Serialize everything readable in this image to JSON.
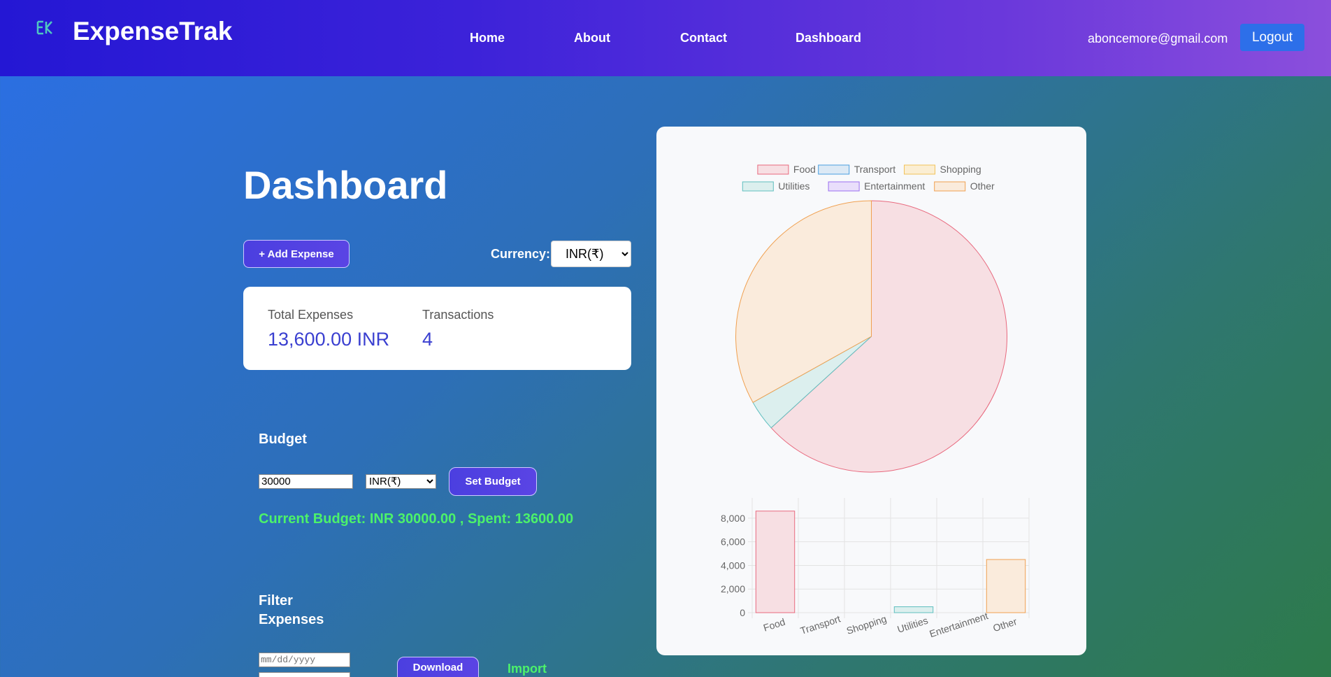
{
  "header": {
    "brand": "ExpenseTrak",
    "nav": [
      {
        "label": "Home"
      },
      {
        "label": "About"
      },
      {
        "label": "Contact"
      },
      {
        "label": "Dashboard"
      }
    ],
    "user_email": "aboncemore@gmail.com",
    "logout_label": "Logout",
    "colors": {
      "accent": "#2d6fe9",
      "nav_start": "#2417d4",
      "nav_end": "#8b4fdc"
    }
  },
  "dashboard": {
    "title": "Dashboard",
    "add_expense_label": "+ Add Expense",
    "currency_label": "Currency:",
    "currency_value": "INR(₹)"
  },
  "summary": {
    "total_label": "Total Expenses",
    "total_value": "13,600.00 INR",
    "transactions_label": "Transactions",
    "transactions_value": "4"
  },
  "budget": {
    "title": "Budget",
    "input_value": "30000",
    "currency_value": "INR(₹)",
    "set_label": "Set Budget",
    "status": "Current Budget: INR 30000.00 , Spent: 13600.00"
  },
  "filter": {
    "title_line1": "Filter",
    "title_line2": "Expenses",
    "date_placeholder": "mm/dd/yyyy",
    "download_label": "Download",
    "import_label": "Import"
  },
  "chart_data": [
    {
      "type": "pie",
      "legend": [
        "Food",
        "Transport",
        "Shopping",
        "Utilities",
        "Entertainment",
        "Other"
      ],
      "legend_placement": "top",
      "categories": [
        "Food",
        "Transport",
        "Shopping",
        "Utilities",
        "Entertainment",
        "Other"
      ],
      "values": [
        8600,
        0,
        0,
        500,
        0,
        4500
      ],
      "colors": [
        "#e8697e",
        "#4a9fe0",
        "#f2c25a",
        "#5fbfbf",
        "#9b6ff0",
        "#f0a050"
      ],
      "fills": [
        "#f7dfe3",
        "#dce9f5",
        "#fbeed3",
        "#dcefee",
        "#e9defb",
        "#faebdc"
      ]
    },
    {
      "type": "bar",
      "categories": [
        "Food",
        "Transport",
        "Shopping",
        "Utilities",
        "Entertainment",
        "Other"
      ],
      "values": [
        8600,
        0,
        0,
        500,
        0,
        4500
      ],
      "ylim": [
        0,
        9000
      ],
      "yticks": [
        "8,000",
        "6,000",
        "4,000",
        "2,000",
        "0"
      ],
      "ytick_values": [
        8000,
        6000,
        4000,
        2000,
        0
      ],
      "grid": true
    }
  ]
}
